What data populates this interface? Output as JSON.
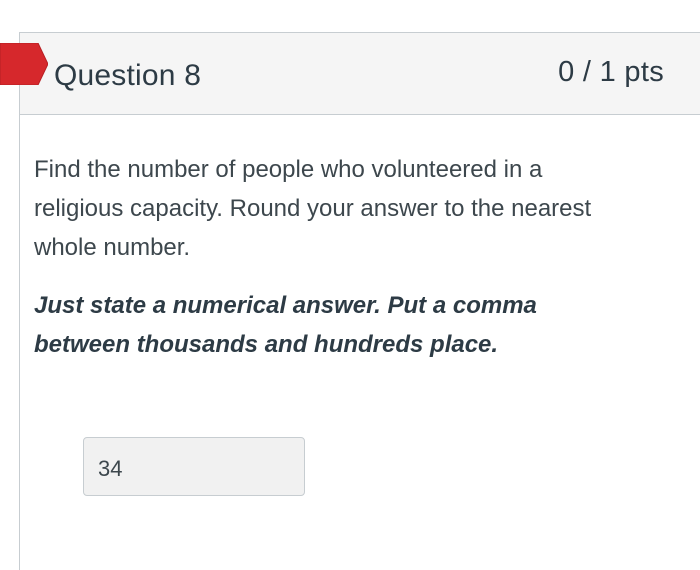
{
  "question": {
    "title": "Question 8",
    "points": "0 / 1 pts",
    "status_flag": "incorrect",
    "flag_color": "#d6282c",
    "prompt": "Find the number of people who volunteered in a religious capacity.  Round your answer to the nearest whole number.",
    "instruction": "Just state a numerical answer. Put a comma between thousands and hundreds place.",
    "answer_value": "34"
  }
}
